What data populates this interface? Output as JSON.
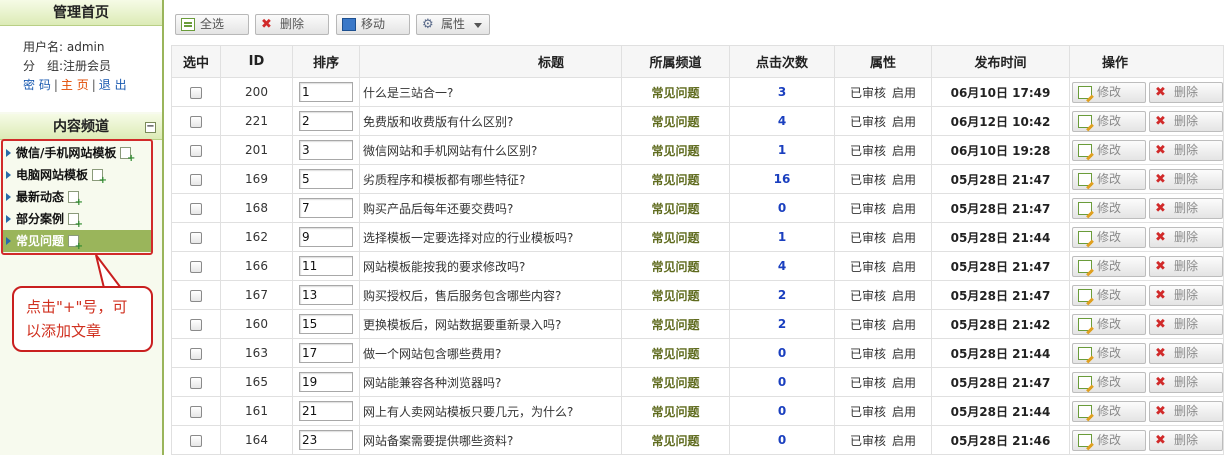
{
  "sidebar": {
    "home_title": "管理首页",
    "user_label": "用户名:",
    "username": "admin",
    "group_label": "分　组:",
    "group": "注册会员",
    "links": [
      "密 码",
      "主 页",
      "退 出"
    ],
    "separator": "|",
    "channel_title": "内容频道",
    "collapse_symbol": "−",
    "channels": [
      "微信/手机网站模板",
      "电脑网站模板",
      "最新动态",
      "部分案例",
      "常见问题"
    ],
    "selected_channel": "常见问题"
  },
  "tooltip": {
    "line1": "点击\"+\"号，可",
    "line2": "以添加文章"
  },
  "toolbar": {
    "select_all": "全选",
    "delete": "删除",
    "move": "移动",
    "properties": "属性"
  },
  "table": {
    "headers": {
      "select": "选中",
      "id": "ID",
      "order": "排序",
      "title": "标题",
      "channel": "所属频道",
      "clicks": "点击次数",
      "attr": "属性",
      "date": "发布时间",
      "ops": "操作"
    },
    "edit_label": "修改",
    "delete_label": "删除",
    "rows": [
      {
        "id": "200",
        "order": "1",
        "title": "什么是三站合一?",
        "channel": "常见问题",
        "clicks": "3",
        "audit": "已审核",
        "status": "启用",
        "date": "06月10日 17:49"
      },
      {
        "id": "221",
        "order": "2",
        "title": "免费版和收费版有什么区别?",
        "channel": "常见问题",
        "clicks": "4",
        "audit": "已审核",
        "status": "启用",
        "date": "06月12日 10:42"
      },
      {
        "id": "201",
        "order": "3",
        "title": "微信网站和手机网站有什么区别?",
        "channel": "常见问题",
        "clicks": "1",
        "audit": "已审核",
        "status": "启用",
        "date": "06月10日 19:28"
      },
      {
        "id": "169",
        "order": "5",
        "title": "劣质程序和模板都有哪些特征?",
        "channel": "常见问题",
        "clicks": "16",
        "audit": "已审核",
        "status": "启用",
        "date": "05月28日 21:47"
      },
      {
        "id": "168",
        "order": "7",
        "title": "购买产品后每年还要交费吗?",
        "channel": "常见问题",
        "clicks": "0",
        "audit": "已审核",
        "status": "启用",
        "date": "05月28日 21:47"
      },
      {
        "id": "162",
        "order": "9",
        "title": "选择模板一定要选择对应的行业模板吗?",
        "channel": "常见问题",
        "clicks": "1",
        "audit": "已审核",
        "status": "启用",
        "date": "05月28日 21:44"
      },
      {
        "id": "166",
        "order": "11",
        "title": "网站模板能按我的要求修改吗?",
        "channel": "常见问题",
        "clicks": "4",
        "audit": "已审核",
        "status": "启用",
        "date": "05月28日 21:47"
      },
      {
        "id": "167",
        "order": "13",
        "title": "购买授权后，售后服务包含哪些内容?",
        "channel": "常见问题",
        "clicks": "2",
        "audit": "已审核",
        "status": "启用",
        "date": "05月28日 21:47"
      },
      {
        "id": "160",
        "order": "15",
        "title": "更换模板后，网站数据要重新录入吗?",
        "channel": "常见问题",
        "clicks": "2",
        "audit": "已审核",
        "status": "启用",
        "date": "05月28日 21:42"
      },
      {
        "id": "163",
        "order": "17",
        "title": "做一个网站包含哪些费用?",
        "channel": "常见问题",
        "clicks": "0",
        "audit": "已审核",
        "status": "启用",
        "date": "05月28日 21:44"
      },
      {
        "id": "165",
        "order": "19",
        "title": "网站能兼容各种浏览器吗?",
        "channel": "常见问题",
        "clicks": "0",
        "audit": "已审核",
        "status": "启用",
        "date": "05月28日 21:47"
      },
      {
        "id": "161",
        "order": "21",
        "title": "网上有人卖网站模板只要几元，为什么?",
        "channel": "常见问题",
        "clicks": "0",
        "audit": "已审核",
        "status": "启用",
        "date": "05月28日 21:44"
      },
      {
        "id": "164",
        "order": "23",
        "title": "网站备案需要提供哪些资料?",
        "channel": "常见问题",
        "clicks": "0",
        "audit": "已审核",
        "status": "启用",
        "date": "05月28日 21:46"
      }
    ]
  }
}
